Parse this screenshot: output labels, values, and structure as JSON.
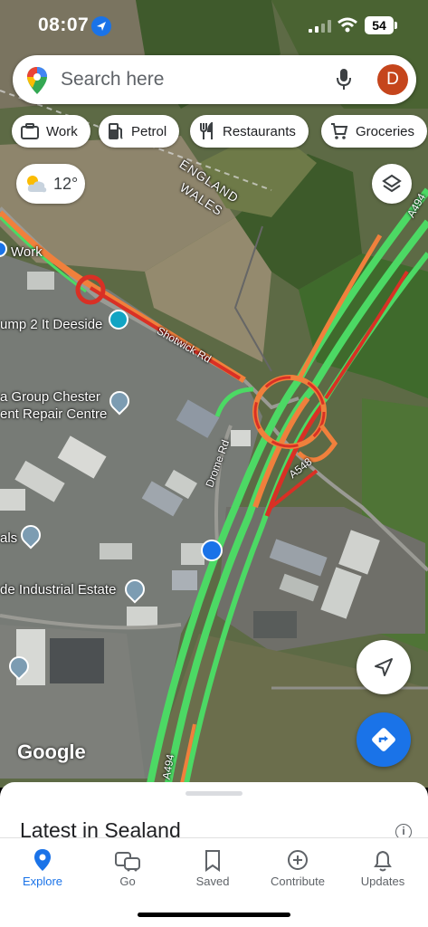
{
  "status_bar": {
    "time": "08:07",
    "battery": "54"
  },
  "search": {
    "placeholder": "Search here",
    "avatar_initial": "D",
    "avatar_color": "#c5451c"
  },
  "chips": [
    {
      "label": "Work",
      "icon": "briefcase-icon"
    },
    {
      "label": "Petrol",
      "icon": "fuel-pump-icon"
    },
    {
      "label": "Restaurants",
      "icon": "fork-knife-icon"
    },
    {
      "label": "Groceries",
      "icon": "cart-icon"
    }
  ],
  "weather": {
    "temperature": "12°",
    "icon": "partly-sunny-icon"
  },
  "map_labels": {
    "boundary_england": "ENGLAND",
    "boundary_wales": "WALES",
    "work": "Work",
    "jump": "ump 2 It Deeside",
    "shotwick_rd": "Shotwick Rd",
    "chester_1": "a Group Chester",
    "chester_2": "ent Repair Centre",
    "drome_rd": "Drome Rd",
    "a548": "A548",
    "a494_top": "A494",
    "a494_bottom": "A494",
    "als": "als",
    "industrial_estate": "de Industrial Estate",
    "google": "Google"
  },
  "colors": {
    "traffic_green": "#4cd964",
    "traffic_orange": "#f0803c",
    "traffic_red": "#d93025",
    "accent_blue": "#1a73e8"
  },
  "sheet": {
    "title": "Latest in Sealand"
  },
  "nav": [
    {
      "label": "Explore",
      "icon": "explore-pin-icon",
      "active": true
    },
    {
      "label": "Go",
      "icon": "commute-icon",
      "active": false
    },
    {
      "label": "Saved",
      "icon": "bookmark-icon",
      "active": false
    },
    {
      "label": "Contribute",
      "icon": "add-circle-icon",
      "active": false
    },
    {
      "label": "Updates",
      "icon": "bell-icon",
      "active": false
    }
  ]
}
